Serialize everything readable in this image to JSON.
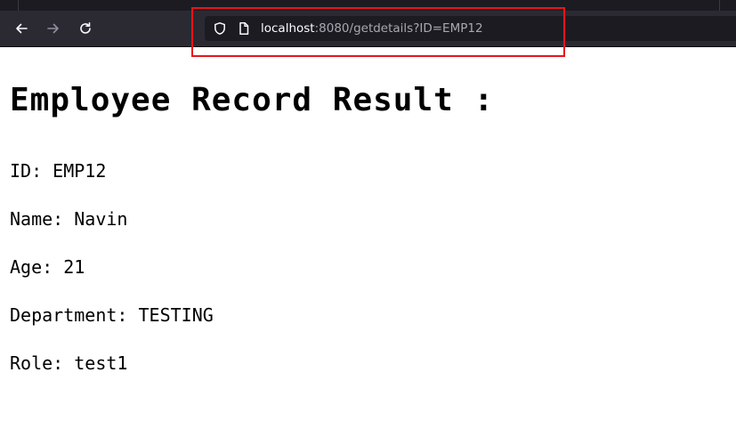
{
  "browser": {
    "url_host": "localhost",
    "url_rest": ":8080/getdetails?ID=EMP12"
  },
  "page": {
    "heading": "Employee Record Result :",
    "fields": [
      "ID: EMP12",
      "Name: Navin",
      "Age: 21",
      "Department: TESTING",
      "Role: test1"
    ]
  },
  "annotation": {
    "highlight_color": "#e8141b",
    "target": "url-bar"
  },
  "theme": {
    "toolbar_bg": "#2b2a33",
    "urlbar_bg": "#1c1b22"
  }
}
